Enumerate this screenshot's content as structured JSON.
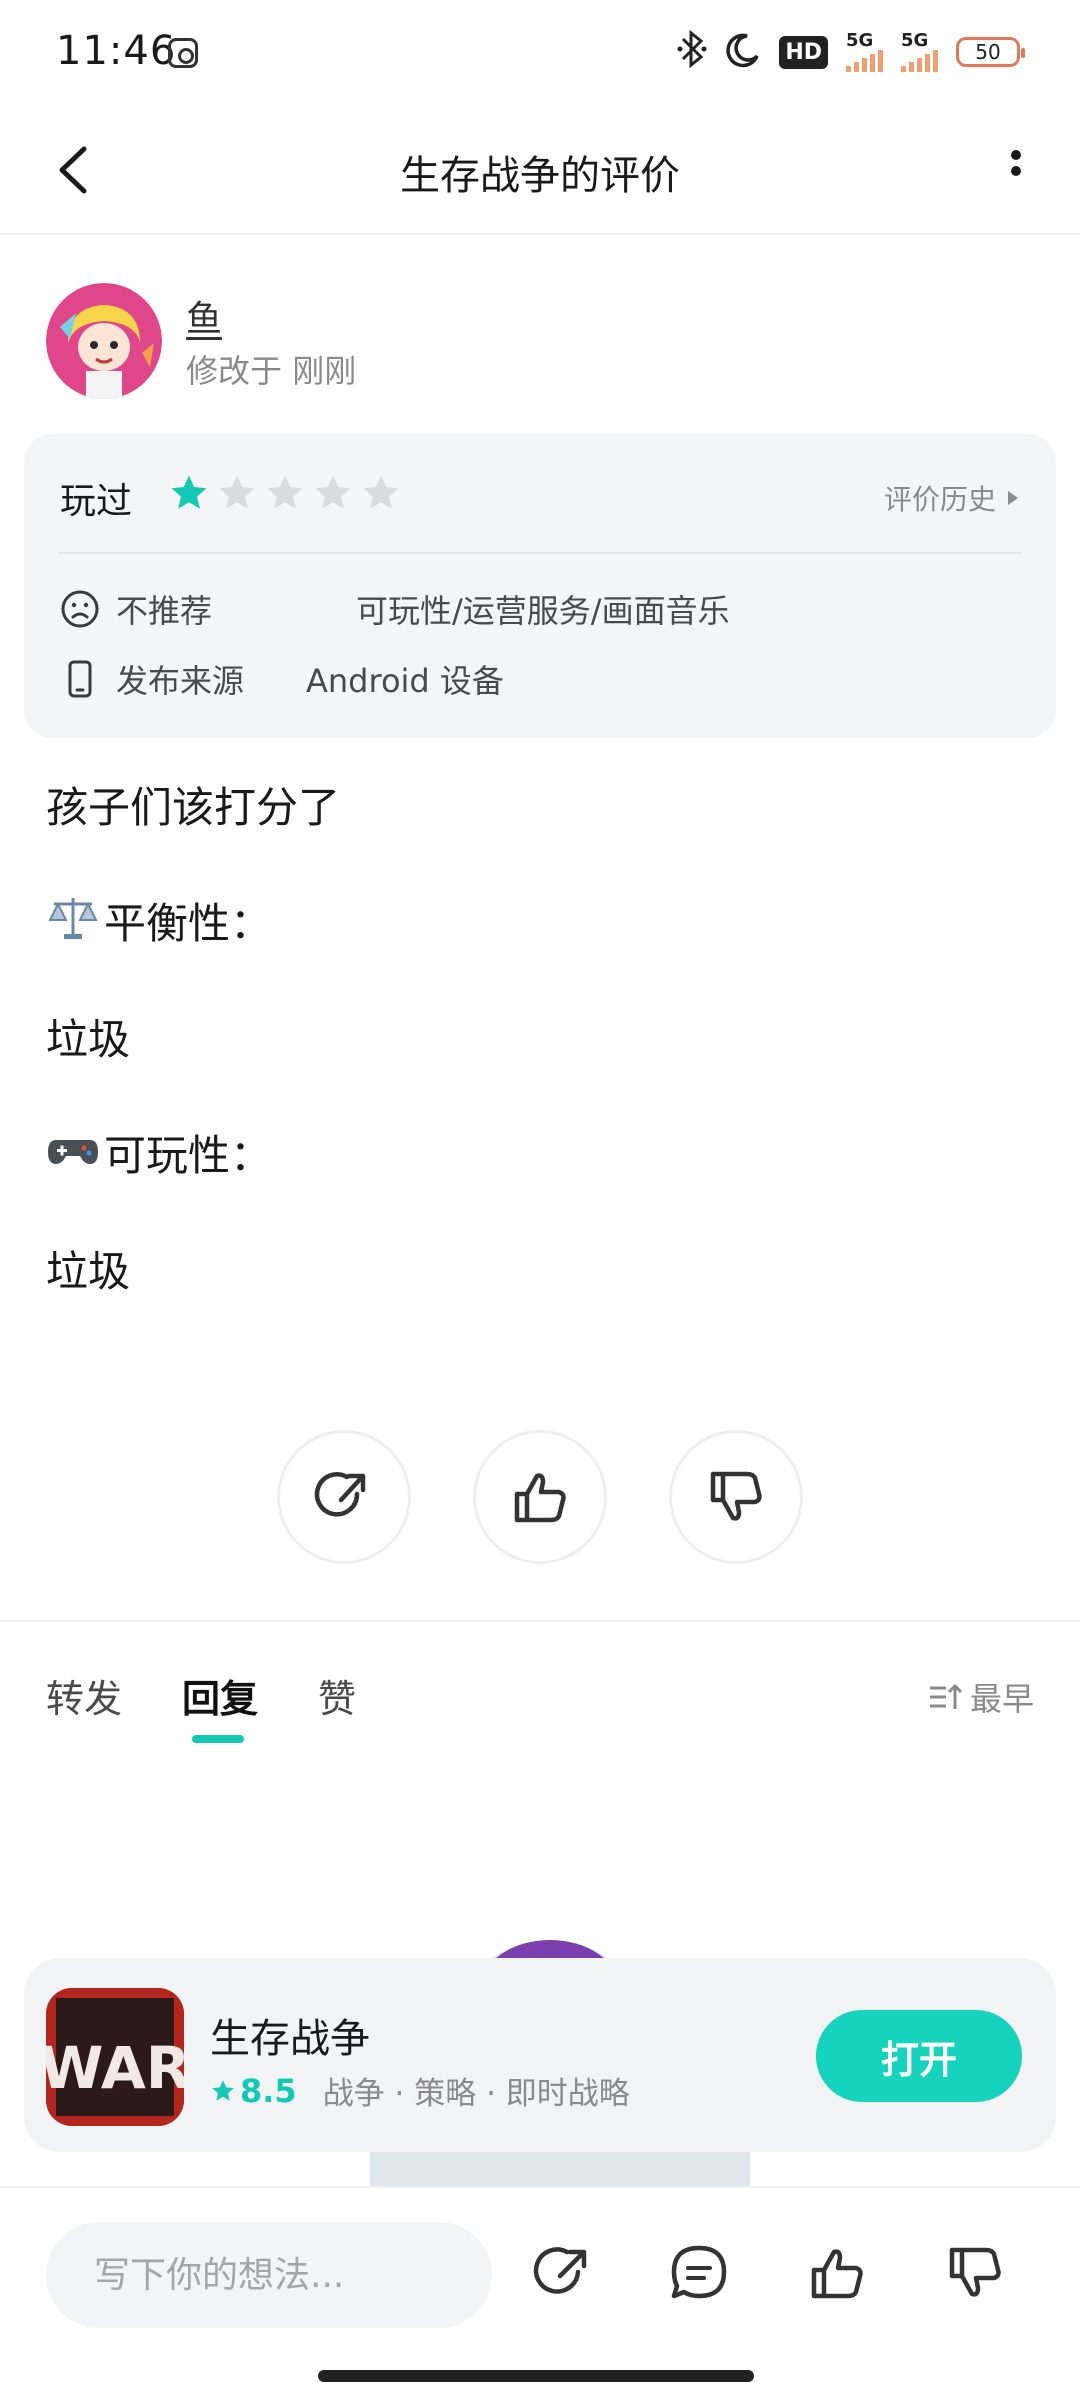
{
  "status_bar": {
    "time": "11:46",
    "network_1": "5G",
    "network_2": "5G",
    "battery": "50",
    "hd_label": "HD"
  },
  "header": {
    "title": "生存战争的评价"
  },
  "author": {
    "name": "鱼",
    "modified_prefix": "修改于",
    "modified_time": "刚刚"
  },
  "rating_card": {
    "played_label": "玩过",
    "stars_filled": 1,
    "stars_total": 5,
    "star_color": "#13c9b5",
    "history_label": "评价历史",
    "recommend_label": "不推荐",
    "recommend_tags": "可玩性/运营服务/画面音乐",
    "source_label": "发布来源",
    "source_value": "Android 设备"
  },
  "review": {
    "line1": "孩子们该打分了",
    "line2": "平衡性：",
    "line3": "垃圾",
    "line4": "可玩性：",
    "line5": "垃圾"
  },
  "tabs": {
    "forward": "转发",
    "reply": "回复",
    "like": "赞",
    "sort": "最早"
  },
  "app_card": {
    "name": "生存战争",
    "score": "8.5",
    "tags": "战争 · 策略 · 即时战略",
    "open_label": "打开",
    "icon_text": "WAR"
  },
  "bottom_bar": {
    "placeholder": "写下你的想法..."
  },
  "colors": {
    "accent": "#13c9b5",
    "card_bg": "#f4f5f7"
  }
}
